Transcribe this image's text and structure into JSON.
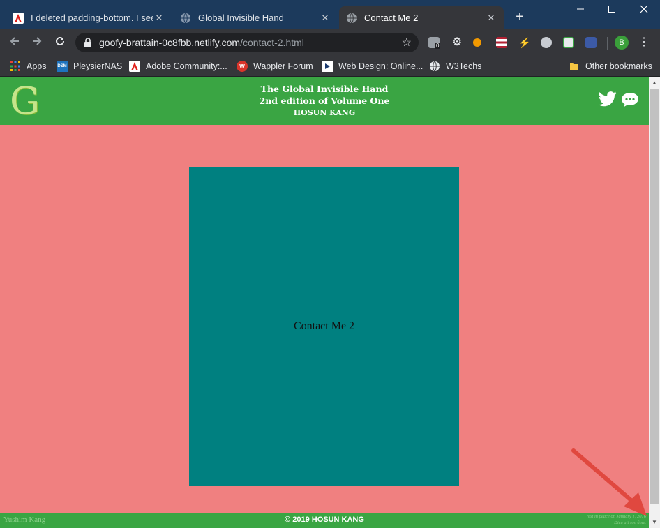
{
  "tabs": [
    {
      "title": "I deleted padding-bottom. I see",
      "favicon": "adobe-icon"
    },
    {
      "title": "Global Invisible Hand",
      "favicon": "globe-icon"
    },
    {
      "title": "Contact Me 2",
      "favicon": "globe-icon",
      "active": true
    }
  ],
  "omnibox": {
    "host": "goofy-brattain-0c8fbb.netlify.com",
    "path": "/contact-2.html"
  },
  "extensions": {
    "badge_count": "0",
    "profile_initial": "B"
  },
  "bookmarks": [
    {
      "label": "Apps",
      "icon": "apps-grid-icon"
    },
    {
      "label": "PleysierNAS",
      "icon": "dsm-icon",
      "icon_text": "DSM"
    },
    {
      "label": "Adobe Community:...",
      "icon": "adobe-icon"
    },
    {
      "label": "Wappler Forum",
      "icon": "wappler-icon"
    },
    {
      "label": "Web Design: Online...",
      "icon": "video-icon"
    },
    {
      "label": "W3Techs",
      "icon": "globe-icon"
    }
  ],
  "other_bookmarks": "Other bookmarks",
  "site": {
    "logo_letter": "G",
    "header": {
      "line1": "The Global Invisible Hand",
      "line2": "2nd edition of Volume One",
      "line3": "HOSUN KANG"
    },
    "box_text": "Contact Me 2",
    "footer": {
      "left": "Yushim Kang",
      "center": "© 2019 HOSUN KANG",
      "right_line1": "rest in peace on January 1, 2016",
      "right_line2": "Dieu ait son âme."
    }
  },
  "colors": {
    "page_background": "#f08080",
    "header_footer_green": "#3aa543",
    "box_teal": "#008080",
    "annotation_arrow": "#e0483f"
  }
}
